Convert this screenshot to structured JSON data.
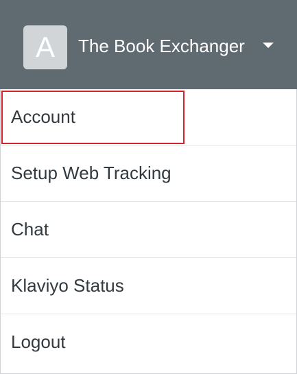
{
  "header": {
    "avatar_letter": "A",
    "account_name": "The Book Exchanger",
    "caret_icon": "caret-down-icon",
    "background_color": "#606a71"
  },
  "menu": {
    "items": [
      {
        "label": "Account",
        "highlighted": true
      },
      {
        "label": "Setup Web Tracking",
        "highlighted": false
      },
      {
        "label": "Chat",
        "highlighted": false
      },
      {
        "label": "Klaviyo Status",
        "highlighted": false
      },
      {
        "label": "Logout",
        "highlighted": false
      }
    ],
    "highlight_color": "#d1242f"
  }
}
